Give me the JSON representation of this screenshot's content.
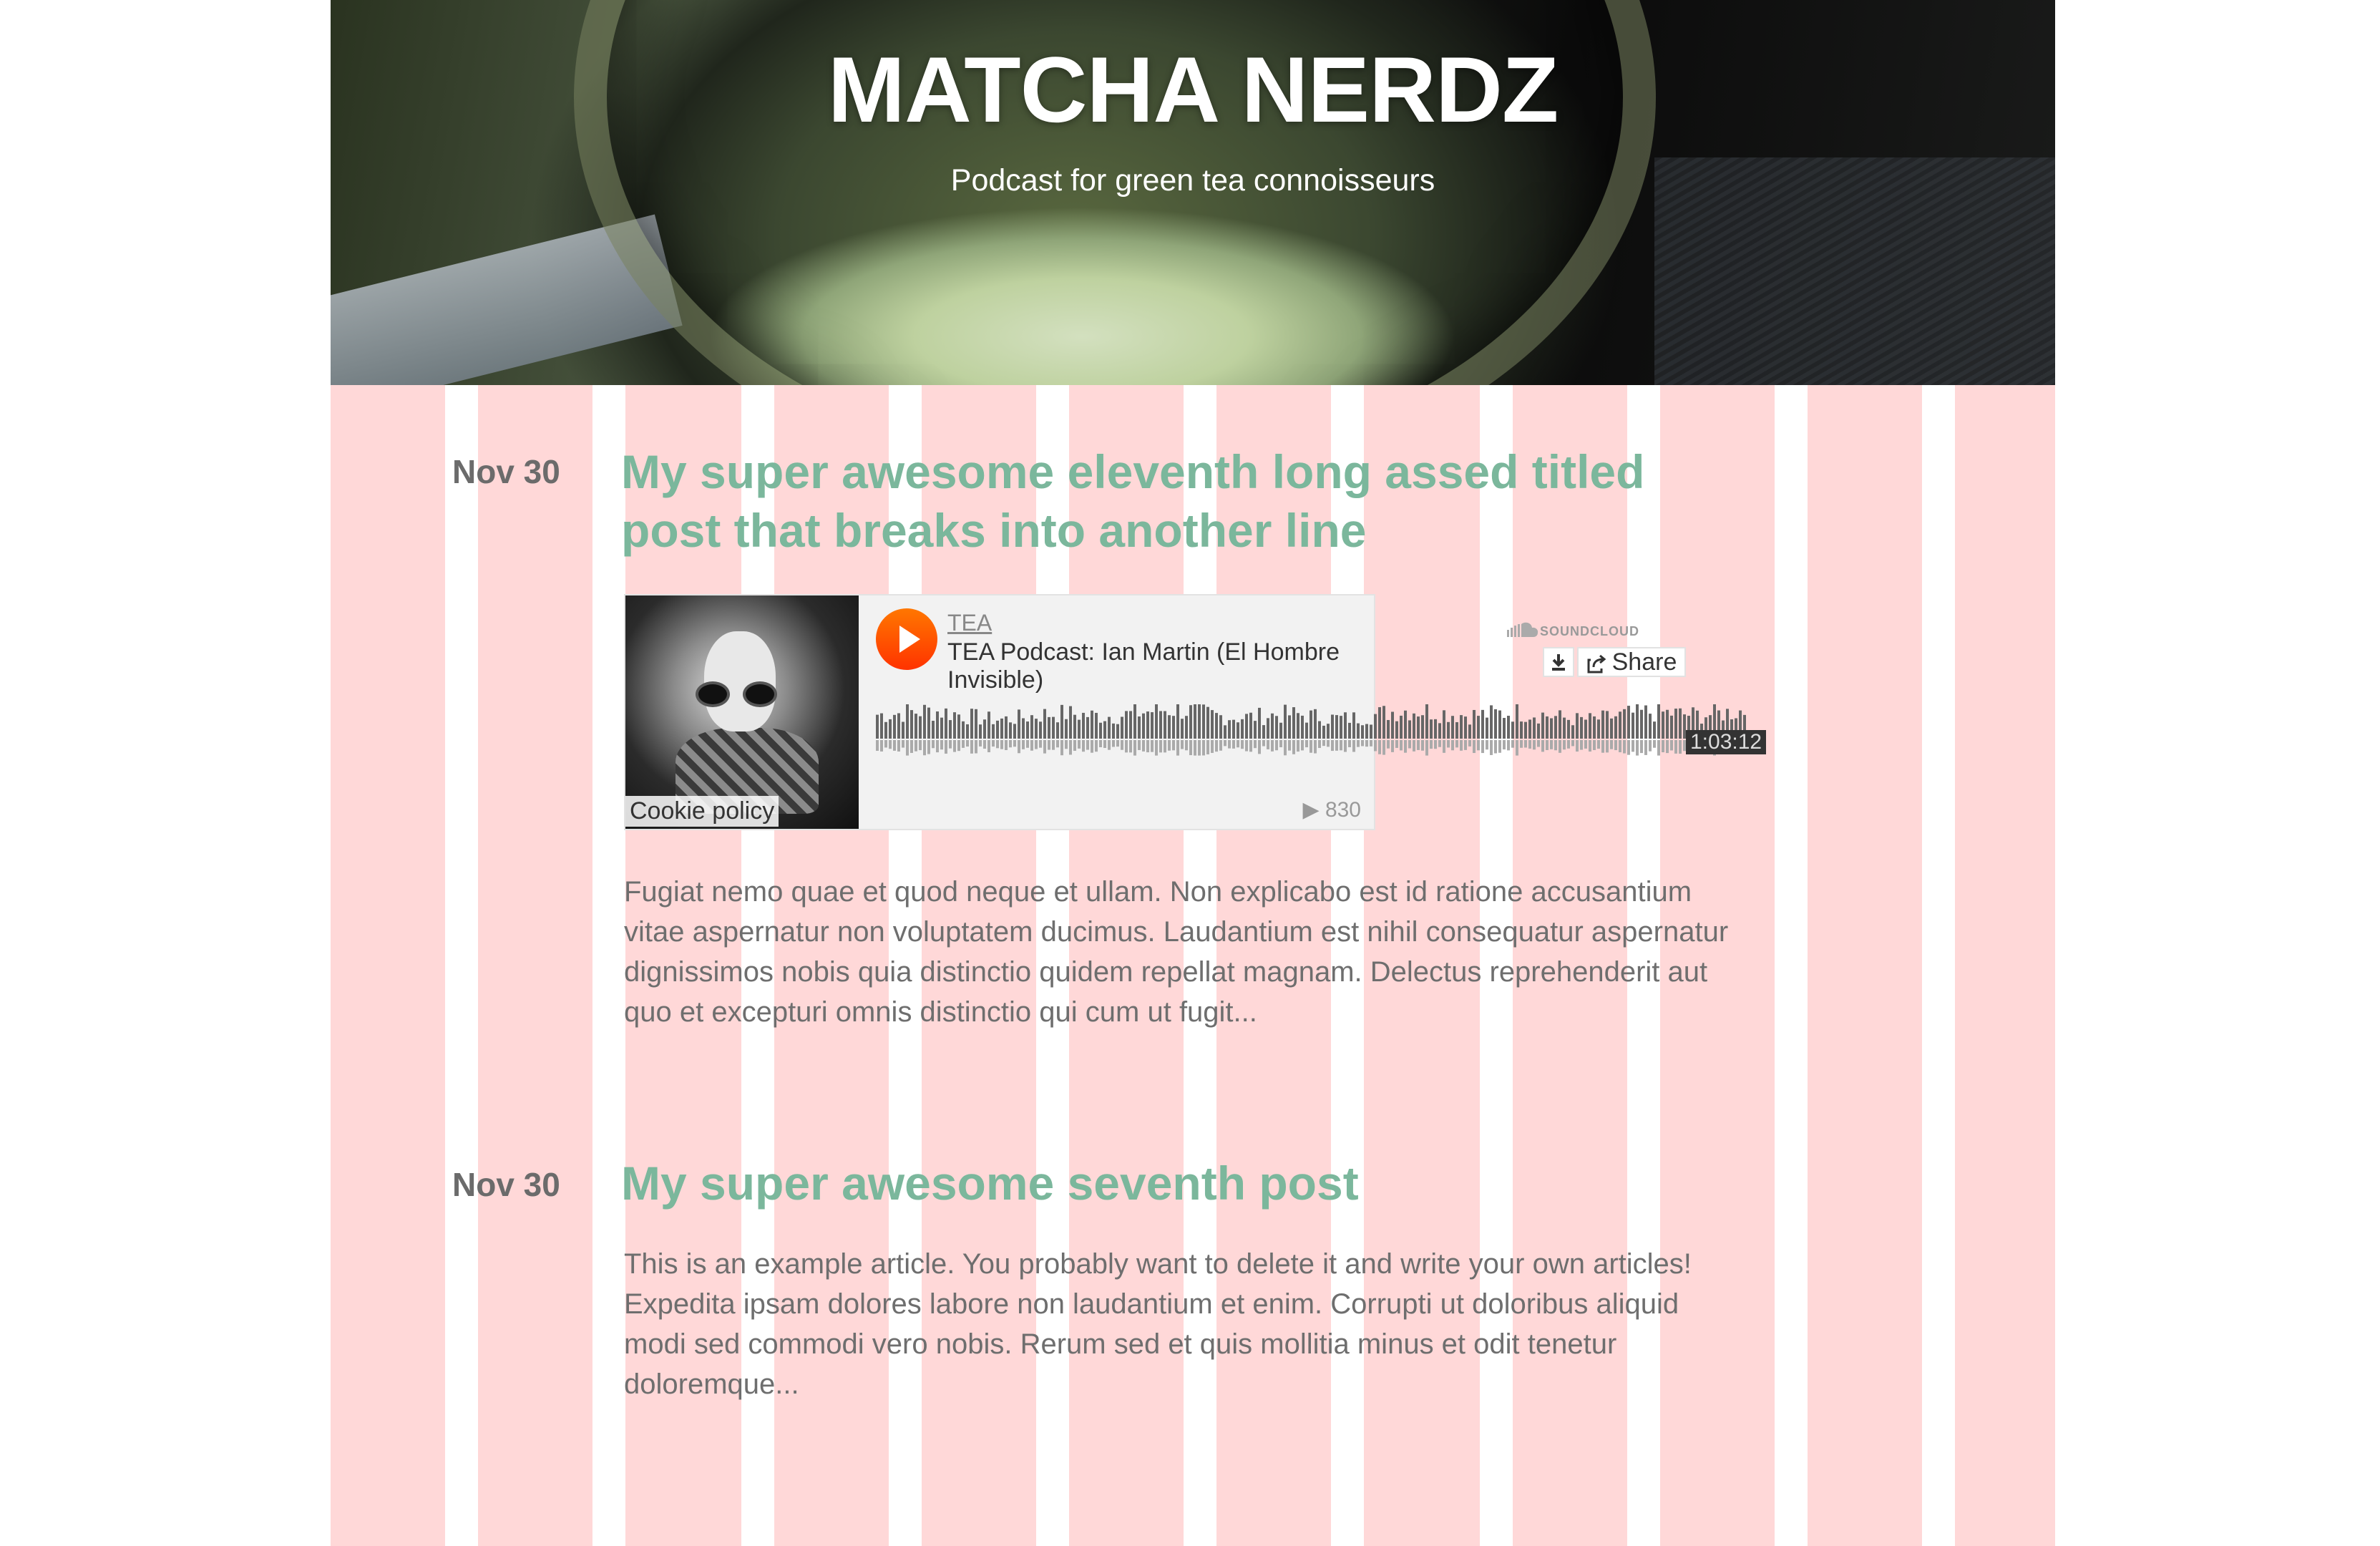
{
  "site": {
    "title": "MATCHA NERDZ",
    "subtitle": "Podcast for green tea connoisseurs"
  },
  "posts": [
    {
      "date": "Nov 30",
      "title": "My super awesome eleventh long assed titled post that breaks into another line",
      "excerpt": "Fugiat nemo quae et quod neque et ullam. Non explicabo est id ratione accusantium vitae aspernatur non voluptatem ducimus. Laudantium est nihil consequatur aspernatur dignissimos nobis quia distinctio quidem repellat magnam. Delectus reprehenderit aut quo et excepturi omnis distinctio qui cum ut fugit..."
    },
    {
      "date": "Nov 30",
      "title": "My super awesome seventh post",
      "excerpt_line1": "This is an example article. You probably want to delete it and write your own articles!",
      "excerpt_line2": "Expedita ipsam dolores labore non laudantium et enim. Corrupti ut doloribus aliquid modi sed commodi vero nobis. Rerum sed et quis mollitia minus et odit tenetur doloremque..."
    }
  ],
  "player": {
    "user": "TEA",
    "track_title": "TEA Podcast: Ian Martin (El Hombre Invisible)",
    "brand": "SOUNDCLOUD",
    "share_label": "Share",
    "duration": "1:03:12",
    "plays": "▶ 830",
    "cookie_label": "Cookie policy",
    "accent": "#ff5500",
    "icons": [
      "play-icon",
      "soundcloud-icon",
      "download-icon",
      "share-icon"
    ]
  },
  "colors": {
    "title_green": "#7bb79c",
    "grid_pink": "#ffd8d8",
    "date_gray": "#6b6b6b",
    "body_gray": "#6e6e6e"
  }
}
